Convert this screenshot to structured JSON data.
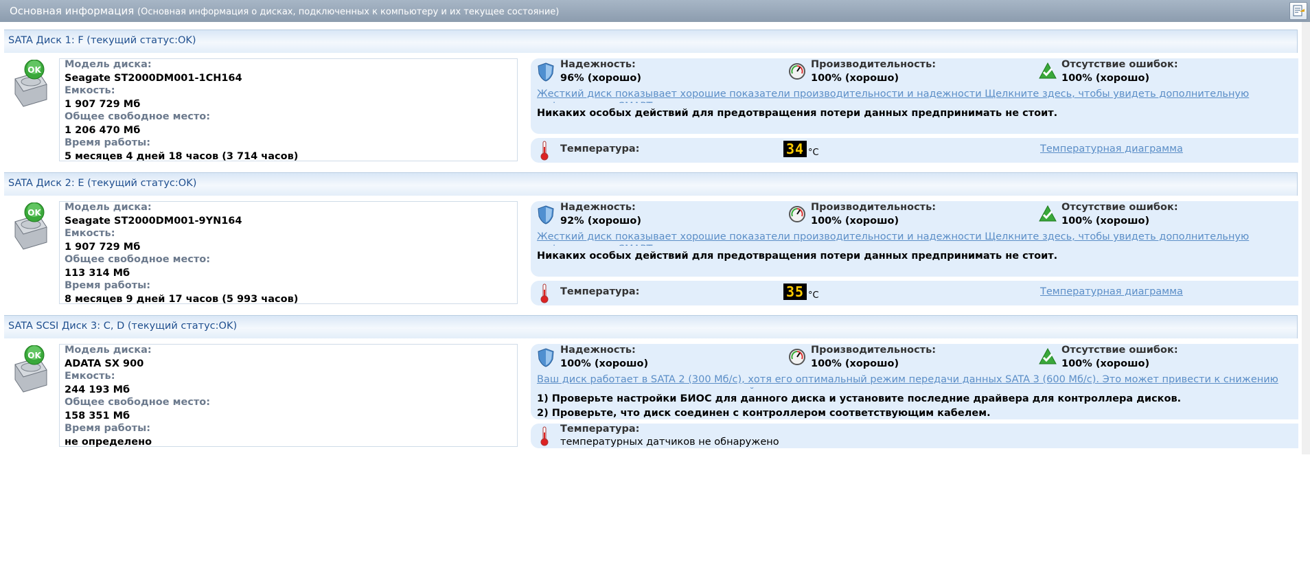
{
  "header": {
    "title": "Основная информация",
    "subtitle": "(Основная информация о дисках, подключенных к компьютеру и  их текущее состояние)"
  },
  "labels": {
    "model": "Модель диска:",
    "capacity": "Емкость:",
    "free": "Общее свободное место:",
    "uptime": "Время работы:",
    "reliability": "Надежность:",
    "performance": "Производительность:",
    "errors": "Отсутствие ошибок:",
    "temperature": "Температура:",
    "temp_unit": "°C",
    "temp_chart": "Температурная диаграмма",
    "ok": "OK"
  },
  "disks": [
    {
      "title": "SATA Диск 1: F (текущий статус:OK)",
      "model": "Seagate ST2000DM001-1CH164",
      "capacity": "1 907 729 Мб",
      "free": "1 206 470 Мб",
      "uptime": "5 месяцев 4 дней 18 часов (3 714 часов)",
      "reliability": "96% (хорошо)",
      "performance": "100% (хорошо)",
      "errors": "100% (хорошо)",
      "description": "Жесткий диск показывает хорошие показатели производительности и надежности Щелкните здесь, чтобы увидеть дополнительную информацию о SMART",
      "action": "Никаких особых действий для предотвращения потери данных предпринимать не стоит.",
      "temperature": "34"
    },
    {
      "title": "SATA Диск 2: E (текущий статус:OK)",
      "model": "Seagate ST2000DM001-9YN164",
      "capacity": "1 907 729 Мб",
      "free": "113 314 Мб",
      "uptime": "8 месяцев 9 дней 17 часов (5 993 часов)",
      "reliability": "92% (хорошо)",
      "performance": "100% (хорошо)",
      "errors": "100% (хорошо)",
      "description": "Жесткий диск показывает хорошие показатели производительности и надежности Щелкните здесь, чтобы увидеть дополнительную информацию о SMART",
      "action": "Никаких особых действий для предотвращения потери данных предпринимать не стоит.",
      "temperature": "35"
    },
    {
      "title": "SATA SCSI Диск 3: C, D (текущий статус:OK)",
      "model": "ADATA SX 900",
      "capacity": "244 193 Мб",
      "free": "158 351 Мб",
      "uptime": "не определено",
      "reliability": "100% (хорошо)",
      "performance": "100% (хорошо)",
      "errors": "100% (хорошо)",
      "description": "Ваш диск работает в SATA 2 (300 Мб/с), хотя его оптимальный режим передачи данных SATA 3 (600 Мб/с). Это может привести к снижению производительности дисковых операций",
      "action_1": "1) Проверьте настройки БИОС для данного диска и установите последние драйвера для контроллера дисков.",
      "action_2": "2) Проверьте, что диск соединен с контроллером соответствующим кабелем.",
      "temp_none": "температурных датчиков не обнаружено"
    }
  ]
}
